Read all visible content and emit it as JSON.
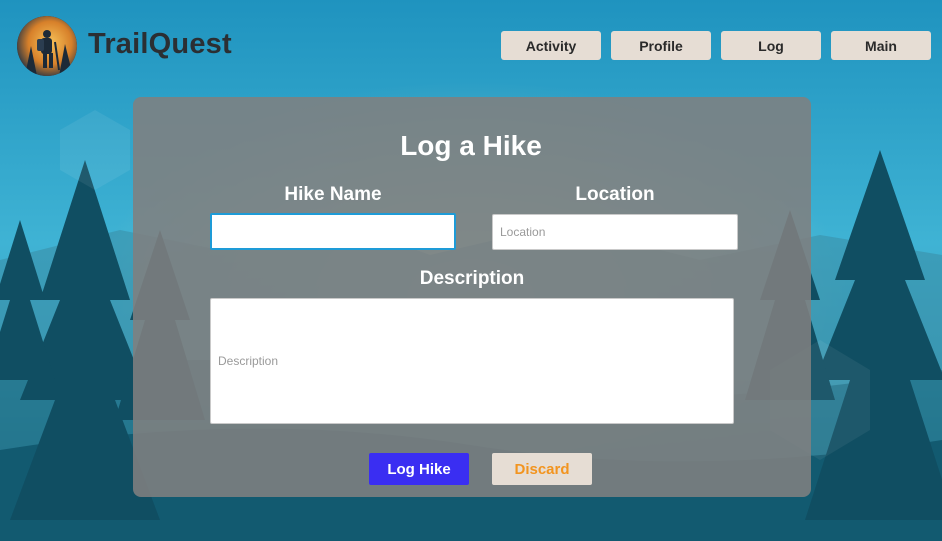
{
  "app": {
    "brand": "TrailQuest"
  },
  "nav": {
    "items": [
      {
        "label": "Activity"
      },
      {
        "label": "Profile"
      },
      {
        "label": "Log"
      },
      {
        "label": "Main"
      }
    ]
  },
  "form": {
    "title": "Log a Hike",
    "hike_name": {
      "label": "Hike Name",
      "value": "",
      "placeholder": ""
    },
    "location": {
      "label": "Location",
      "value": "",
      "placeholder": "Location"
    },
    "description": {
      "label": "Description",
      "value": "",
      "placeholder": "Description"
    },
    "submit_label": "Log Hike",
    "discard_label": "Discard"
  },
  "colors": {
    "primary_button": "#3a2ef2",
    "secondary_button": "#e6ddd4",
    "discard_text": "#f2941f",
    "focus_border": "#1e9bd7"
  },
  "icons": {
    "logo": "hiker-logo-icon"
  }
}
